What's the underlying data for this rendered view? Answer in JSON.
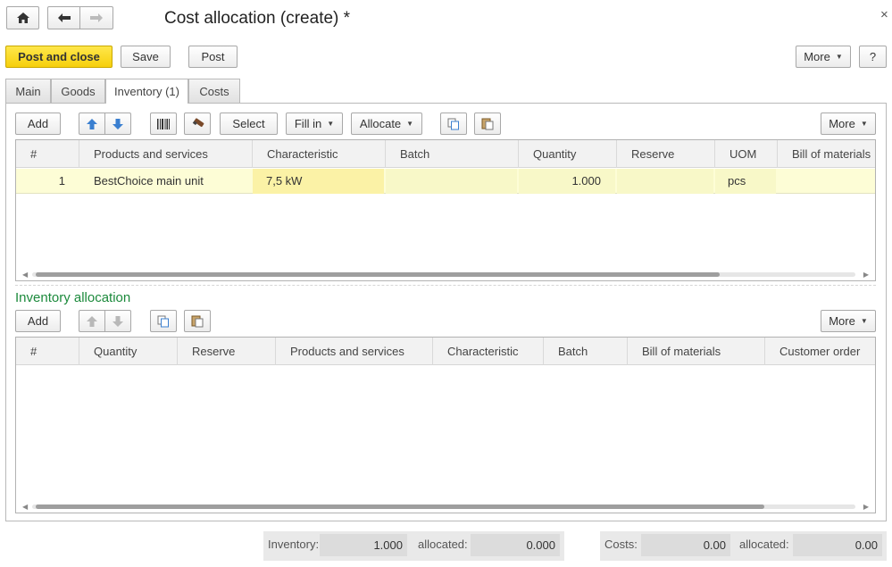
{
  "window": {
    "title": "Cost allocation (create) *",
    "close_glyph": "×"
  },
  "nav": {
    "home_icon": "home-icon",
    "back_icon": "arrow-left-icon",
    "forward_icon": "arrow-right-icon"
  },
  "toolbar": {
    "post_and_close": "Post and close",
    "save": "Save",
    "post": "Post",
    "more": "More",
    "help": "?"
  },
  "tabs": [
    {
      "label": "Main"
    },
    {
      "label": "Goods"
    },
    {
      "label": "Inventory (1)"
    },
    {
      "label": "Costs"
    }
  ],
  "inventory_toolbar": {
    "add": "Add",
    "select": "Select",
    "fill_in": "Fill in",
    "allocate": "Allocate",
    "more": "More"
  },
  "inventory_table": {
    "columns": [
      "#",
      "Products and services",
      "Characteristic",
      "Batch",
      "Quantity",
      "Reserve",
      "UOM",
      "Bill of materials"
    ],
    "rows": [
      {
        "num": "1",
        "product": "BestChoice main unit",
        "characteristic": "7,5 kW",
        "batch": "",
        "quantity": "1.000",
        "reserve": "",
        "uom": "pcs",
        "bom": ""
      }
    ]
  },
  "allocation": {
    "title": "Inventory allocation",
    "add": "Add",
    "more": "More",
    "columns": [
      "#",
      "Quantity",
      "Reserve",
      "Products and services",
      "Characteristic",
      "Batch",
      "Bill of materials",
      "Customer order"
    ]
  },
  "totals": {
    "inventory_label": "Inventory:",
    "inventory_value": "1.000",
    "allocated_label": "allocated:",
    "inventory_allocated": "0.000",
    "costs_label": "Costs:",
    "costs_value": "0.00",
    "costs_allocated": "0.00"
  },
  "colors": {
    "primary_button": "#f6cf0c",
    "selected_row": "#fdfdd6",
    "section_title": "#1c8a3c",
    "arrow_blue": "#3a7fd0"
  }
}
